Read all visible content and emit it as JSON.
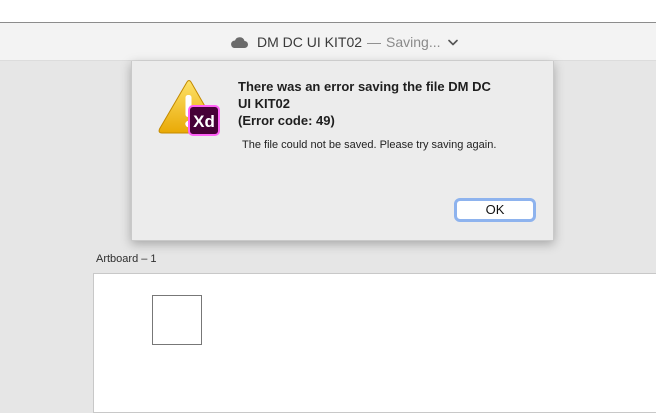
{
  "titlebar": {
    "icon": "cloud-icon",
    "document_name": "DM DC UI KIT02",
    "separator": "—",
    "status": "Saving...",
    "dropdown_icon": "chevron-down-icon"
  },
  "canvas": {
    "artboard_label": "Artboard – 1"
  },
  "dialog": {
    "icon": "warning-xd-icon",
    "title_line1": "There was an error saving the file DM DC",
    "title_line2": "UI KIT02",
    "title_line3": "(Error code: 49)",
    "message": "The file could not be saved. Please try saving again.",
    "ok_label": "OK"
  },
  "colors": {
    "warning_yellow": "#f1c40f",
    "xd_badge": "#470137",
    "xd_accent": "#ff61f6",
    "focus_ring": "#8eb3ee"
  }
}
